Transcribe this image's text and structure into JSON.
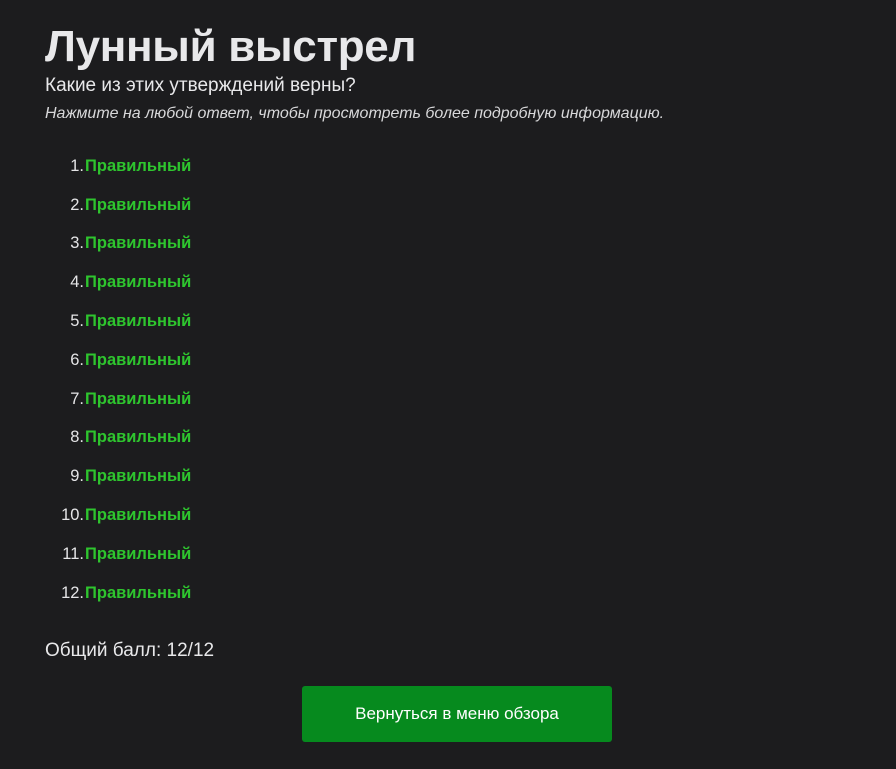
{
  "page": {
    "title": "Лунный выстрел",
    "question": "Какие из этих утверждений верны?",
    "hint": "Нажмите на любой ответ, чтобы просмотреть более подробную информацию."
  },
  "answers": [
    {
      "number": "1.",
      "label": "Правильный"
    },
    {
      "number": "2.",
      "label": "Правильный"
    },
    {
      "number": "3.",
      "label": "Правильный"
    },
    {
      "number": "4.",
      "label": "Правильный"
    },
    {
      "number": "5.",
      "label": "Правильный"
    },
    {
      "number": "6.",
      "label": "Правильный"
    },
    {
      "number": "7.",
      "label": "Правильный"
    },
    {
      "number": "8.",
      "label": "Правильный"
    },
    {
      "number": "9.",
      "label": "Правильный"
    },
    {
      "number": "10.",
      "label": "Правильный"
    },
    {
      "number": "11.",
      "label": "Правильный"
    },
    {
      "number": "12.",
      "label": "Правильный"
    }
  ],
  "score": {
    "text": "Общий балл: 12/12"
  },
  "actions": {
    "back_label": "Вернуться в меню обзора"
  },
  "colors": {
    "background": "#1c1c1e",
    "correct": "#2ec52e",
    "button": "#068a1e"
  }
}
